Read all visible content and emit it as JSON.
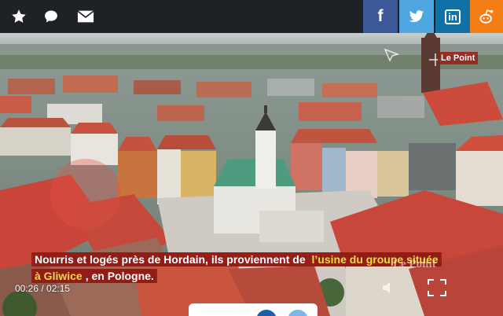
{
  "toolbar": {
    "icons": [
      "star-icon",
      "chat-icon",
      "mail-icon"
    ]
  },
  "share": {
    "facebook": {
      "glyph": "f",
      "color": "#3b5998"
    },
    "twitter": {
      "color": "#4fa6e0"
    },
    "linkedin": {
      "glyph": "in",
      "color": "#0f71a6"
    },
    "reddit": {
      "color": "#f57d18"
    }
  },
  "video": {
    "brand_top": "Le Point",
    "brand_watermark": "Le Point",
    "subtitle_line1_plain": "Nourris et logés près de Hordain, ils proviennent de ",
    "subtitle_line1_highlight": "l’usine du groupe située",
    "subtitle_line2_highlight": "à Gliwice",
    "subtitle_line2_plain": ", en Pologne.",
    "timecode": "00:26 / 02:15",
    "accent_red": "#911c16",
    "highlight_yellow": "#f4d84a"
  }
}
